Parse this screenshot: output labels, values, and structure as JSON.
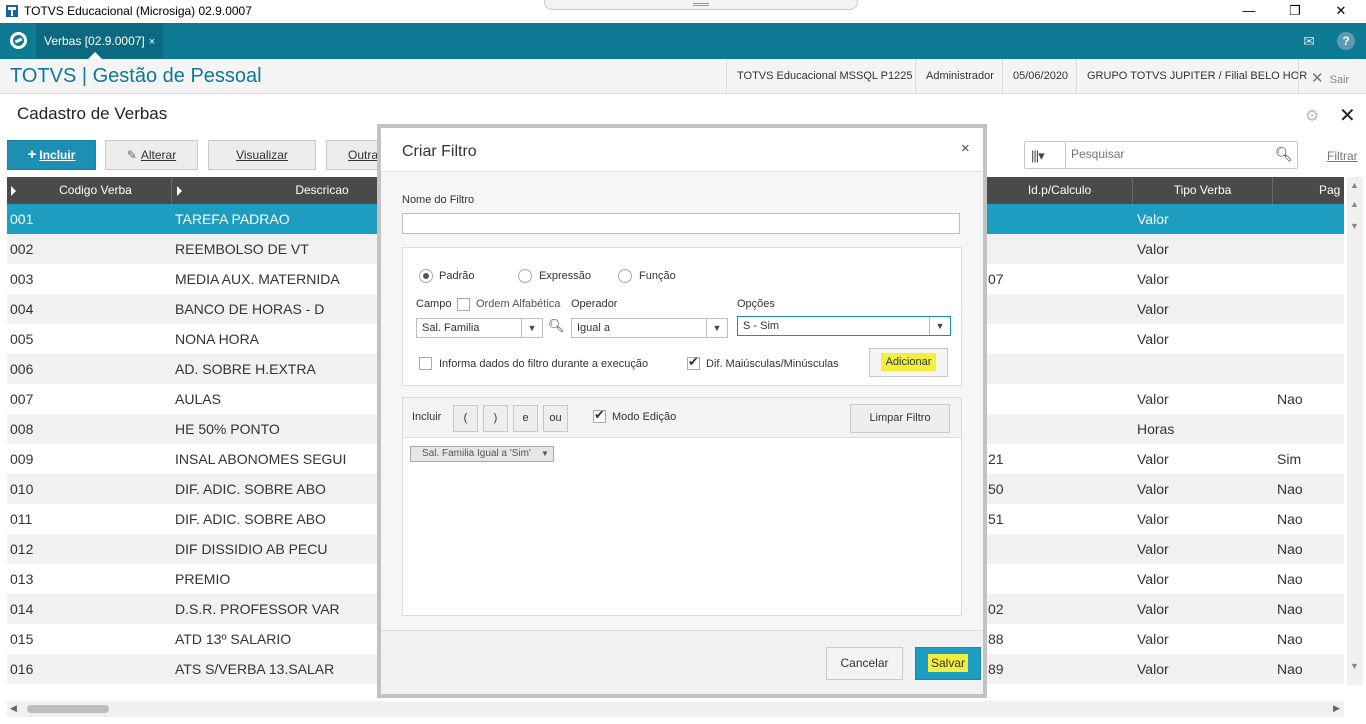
{
  "window": {
    "title": "TOTVS Educacional (Microsiga) 02.9.0007",
    "minimize": "—",
    "restore": "❐",
    "close": "✕"
  },
  "tabbar": {
    "tab_label": "Verbas [02.9.0007]",
    "tab_close": "×",
    "mail_icon": "✉",
    "help_icon": "?"
  },
  "header": {
    "app_title": "TOTVS | Gestão de Pessoal",
    "environment": "TOTVS Educacional MSSQL P1225",
    "user": "Administrador",
    "date": "05/06/2020",
    "branch": "GRUPO TOTVS JUPITER / Filial BELO HOR",
    "exit_icon": "✕",
    "exit_label": "Sair"
  },
  "page": {
    "title": "Cadastro de Verbas",
    "close_icon": "✕"
  },
  "toolbar": {
    "include": "Incluir",
    "include_icon": "+",
    "edit": "Alterar",
    "edit_icon": "✎",
    "view": "Visualizar",
    "others": "Outras",
    "search_placeholder": "Pesquisar",
    "filter": "Filtrar"
  },
  "grid": {
    "columns": {
      "codigo": "Codigo Verba",
      "descricao": "Descricao",
      "idcalculo": "Id.p/Calculo",
      "tipo": "Tipo Verba",
      "pag": "Pag"
    },
    "rows": [
      {
        "codigo": "001",
        "descricao": "TAREFA PADRAO",
        "idcalculo": "",
        "tipo": "Valor",
        "pag": ""
      },
      {
        "codigo": "002",
        "descricao": "REEMBOLSO DE VT",
        "idcalculo": "",
        "tipo": "Valor",
        "pag": ""
      },
      {
        "codigo": "003",
        "descricao": "MEDIA AUX. MATERNIDA",
        "idcalculo": "07",
        "tipo": "Valor",
        "pag": ""
      },
      {
        "codigo": "004",
        "descricao": "BANCO DE HORAS - D",
        "idcalculo": "",
        "tipo": "Valor",
        "pag": ""
      },
      {
        "codigo": "005",
        "descricao": "NONA HORA",
        "idcalculo": "",
        "tipo": "Valor",
        "pag": ""
      },
      {
        "codigo": "006",
        "descricao": "AD. SOBRE H.EXTRA",
        "idcalculo": "",
        "tipo": "",
        "pag": ""
      },
      {
        "codigo": "007",
        "descricao": "AULAS",
        "idcalculo": "",
        "tipo": "Valor",
        "pag": "Nao"
      },
      {
        "codigo": "008",
        "descricao": "HE 50% PONTO",
        "idcalculo": "",
        "tipo": "Horas",
        "pag": ""
      },
      {
        "codigo": "009",
        "descricao": "INSAL ABONOMES SEGUI",
        "idcalculo": "21",
        "tipo": "Valor",
        "pag": "Sim"
      },
      {
        "codigo": "010",
        "descricao": "DIF. ADIC. SOBRE ABO",
        "idcalculo": "50",
        "tipo": "Valor",
        "pag": "Nao"
      },
      {
        "codigo": "011",
        "descricao": "DIF. ADIC. SOBRE ABO",
        "idcalculo": "51",
        "tipo": "Valor",
        "pag": "Nao"
      },
      {
        "codigo": "012",
        "descricao": "DIF DISSIDIO AB PECU",
        "idcalculo": "",
        "tipo": "Valor",
        "pag": "Nao"
      },
      {
        "codigo": "013",
        "descricao": "PREMIO",
        "idcalculo": "",
        "tipo": "Valor",
        "pag": "Nao"
      },
      {
        "codigo": "014",
        "descricao": "D.S.R. PROFESSOR VAR",
        "idcalculo": "02",
        "tipo": "Valor",
        "pag": "Nao"
      },
      {
        "codigo": "015",
        "descricao": "ATD 13º SALARIO",
        "idcalculo": "88",
        "tipo": "Valor",
        "pag": "Nao"
      },
      {
        "codigo": "016",
        "descricao": "ATS S/VERBA 13.SALAR",
        "idcalculo": "89",
        "tipo": "Valor",
        "pag": "Nao"
      }
    ]
  },
  "dialog": {
    "title": "Criar Filtro",
    "close_icon": "×",
    "filter_name_label": "Nome do Filtro",
    "filter_name_value": "",
    "radio_padrao": "Padrão",
    "radio_expressao": "Expressão",
    "radio_funcao": "Função",
    "campo_label": "Campo",
    "ordem_alfabetica": "Ordem Alfabética",
    "operador_label": "Operador",
    "opcoes_label": "Opções",
    "campo_value": "Sal. Familia",
    "operador_value": "Igual a",
    "opcoes_value": "S - Sim",
    "informa_dados": "Informa dados do filtro durante a execução",
    "dif_maiusculas": "Dif. Maiúsculas/Minúsculas",
    "adicionar": "Adicionar",
    "incluir_label": "Incluir",
    "paren_open": "(",
    "paren_close": ")",
    "and_button": "e",
    "or_button": "ou",
    "modo_edicao": "Modo Edição",
    "limpar_filtro": "Limpar Filtro",
    "expression_chip": "Sal. Familia Igual a 'Sim'",
    "cancel": "Cancelar",
    "save": "Salvar"
  },
  "colors": {
    "teal": "#0e7a93",
    "selected_row": "#1d9dc0",
    "primary_button": "#1d8fb4",
    "highlight": "#f2ef3b"
  }
}
